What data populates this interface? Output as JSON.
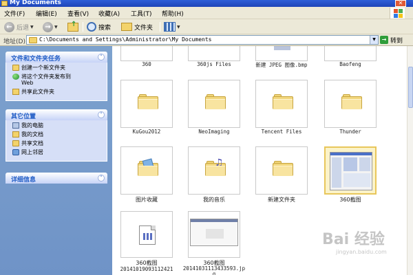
{
  "window": {
    "title": "My Documents",
    "close_glyph": "✕"
  },
  "menu": [
    "文件(F)",
    "编辑(E)",
    "查看(V)",
    "收藏(A)",
    "工具(T)",
    "帮助(H)"
  ],
  "toolbar": {
    "back_label": "后退",
    "search_label": "搜索",
    "folders_label": "文件夹"
  },
  "address": {
    "label": "地址(D)",
    "path": "C:\\Documents and Settings\\Administrator\\My Documents",
    "go_label": "转到"
  },
  "panels": {
    "file_tasks": {
      "title": "文件和文件夹任务",
      "items": [
        "创建一个新文件夹",
        "将这个文件夹发布到",
        "Web",
        "共享此文件夹"
      ]
    },
    "other_places": {
      "title": "其它位置",
      "items": [
        "我的电脑",
        "我的文档",
        "共享文档",
        "网上邻居"
      ]
    },
    "details": {
      "title": "详细信息"
    }
  },
  "files": {
    "row0": [
      "360",
      "360js Files",
      "新建 JPEG 图像.bmp",
      "Baofeng"
    ],
    "row1": [
      "KuGou2012",
      "NeoImaging",
      "Tencent Files",
      "Thunder"
    ],
    "row2": [
      "图片收藏",
      "我的音乐",
      "新建文件夹",
      "360截图"
    ],
    "row3": [
      {
        "line1": "360截图",
        "line2": "20141019093112421"
      },
      {
        "line1": "360截图",
        "line2": "20141031113433593.jp",
        "line3": "g"
      }
    ]
  },
  "watermark": {
    "main": "Bai 经验",
    "sub": "jingyan.baidu.com"
  }
}
